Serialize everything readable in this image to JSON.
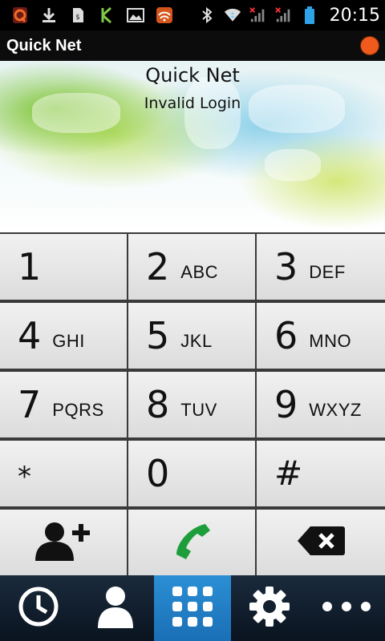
{
  "status_bar": {
    "time": "20:15",
    "icons": [
      "quickoffice-icon",
      "download-icon",
      "sim-toolkit-icon",
      "k-app-icon",
      "gallery-icon",
      "wifi-hotspot-icon"
    ],
    "right_icons": [
      "bluetooth-icon",
      "wifi-icon",
      "signal-sim1-icon",
      "signal-sim2-icon",
      "battery-icon"
    ]
  },
  "titlebar": {
    "title": "Quick Net"
  },
  "banner": {
    "title": "Quick Net",
    "status": "Invalid Login"
  },
  "keypad": {
    "keys": [
      {
        "digit": "1",
        "letters": ""
      },
      {
        "digit": "2",
        "letters": "ABC"
      },
      {
        "digit": "3",
        "letters": "DEF"
      },
      {
        "digit": "4",
        "letters": "GHI"
      },
      {
        "digit": "5",
        "letters": "JKL"
      },
      {
        "digit": "6",
        "letters": "MNO"
      },
      {
        "digit": "7",
        "letters": "PQRS"
      },
      {
        "digit": "8",
        "letters": "TUV"
      },
      {
        "digit": "9",
        "letters": "WXYZ"
      },
      {
        "digit": "*",
        "letters": ""
      },
      {
        "digit": "0",
        "letters": ""
      },
      {
        "digit": "#",
        "letters": ""
      }
    ],
    "actions": [
      "add-contact-icon",
      "call-icon",
      "backspace-icon"
    ],
    "call_color": "#1e9e3a"
  },
  "bottom_nav": {
    "items": [
      "history-icon",
      "contacts-icon",
      "dialpad-icon",
      "settings-icon",
      "more-icon"
    ],
    "active": "dialpad-icon",
    "active_color": "#1f7fc8"
  }
}
